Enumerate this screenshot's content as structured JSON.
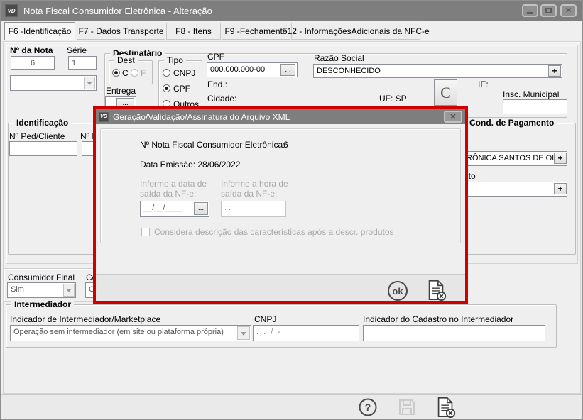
{
  "window": {
    "title": "Nota Fiscal Consumidor Eletrônica - Alteração",
    "logo": "VD"
  },
  "tabs": [
    {
      "pre": "F6 - ",
      "key": "I",
      "post": "dentificação",
      "active": true
    },
    {
      "pre": "F7 - Dados Transporte",
      "key": "",
      "post": "",
      "active": false
    },
    {
      "pre": "F8 - I",
      "key": "t",
      "post": "ens",
      "active": false
    },
    {
      "pre": "F9 - ",
      "key": "F",
      "post": "echamento",
      "active": false
    },
    {
      "pre": "F12 - Informações ",
      "key": "A",
      "post": "dicionais da NFC-e",
      "active": false
    }
  ],
  "form": {
    "nota_label": "Nº da Nota",
    "nota_value": "6",
    "serie_label": "Série",
    "serie_value": "1",
    "destinatario": {
      "title": "Destinatário",
      "dest_title": "Dest",
      "dest_options": [
        "C",
        "F"
      ],
      "dest_selected": "C",
      "tipo_title": "Tipo",
      "tipo_options": [
        "CNPJ",
        "CPF",
        "Outros"
      ],
      "tipo_selected": "CPF",
      "entrega_label": "Entrega",
      "cpf_label": "CPF",
      "cpf_value": "000.000.000-00",
      "razao_label": "Razão Social",
      "razao_value": "DESCONHECIDO",
      "end_label": "End.:",
      "cidade_label": "Cidade:",
      "uf_label": "UF: SP",
      "c_button": "C",
      "ie_label": "IE:",
      "insc_label": "Insc. Municipal"
    },
    "identificacao": {
      "title": "Identificação",
      "ped_label": "Nº Ped/Cliente",
      "ped2_label": "Nº P"
    },
    "pagamento": {
      "title": "Cond. de Pagamento",
      "vendedor_label": "r",
      "vendedor_value": "RÔNICA SANTOS DE OLIVE",
      "pagto_label": "gto"
    },
    "consumidor": {
      "final_label": "Consumidor Final",
      "final_value": "Sim",
      "presente_label": "Co",
      "presente_value": "O"
    },
    "intermediador": {
      "title": "Intermediador",
      "indicador_label": "Indicador de Intermediador/Marketplace",
      "indicador_value": "Operação sem intermediador (em site ou plataforma própria)",
      "cnpj_label": "CNPJ",
      "cnpj_mask": ".  .  /  -",
      "cadastro_label": "Indicador do Cadastro no Intermediador"
    }
  },
  "dialog": {
    "title": "Geração/Validação/Assinatura do Arquivo XML",
    "logo": "VD",
    "nota_label": "Nº Nota Fiscal Consumidor Eletrônica:",
    "nota_value": "6",
    "emissao_text": "Data Emissão: 28/06/2022",
    "data_label_1": "Informe a data de",
    "data_label_2": "saída da NF-e:",
    "hora_label_1": "Informe a hora de",
    "hora_label_2": "saída da NF-e:",
    "date_mask": "__/__/____",
    "time_mask": ":  :",
    "checkbox_label": "Considera descrição das características após a descr. produtos",
    "ok_label": "ok"
  },
  "misc": {
    "more_label": "...",
    "plus_label": "+",
    "help_glyph": "?",
    "close_glyph": "✕"
  },
  "colors": {
    "alert_border": "#d10000",
    "titlebar": "#7e7e7e"
  }
}
